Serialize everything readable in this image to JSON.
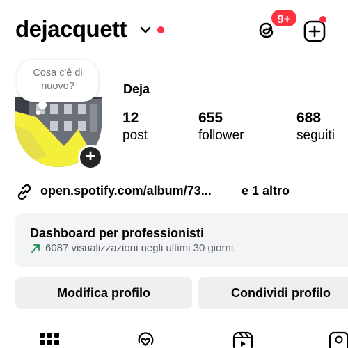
{
  "header": {
    "username": "dejacquett",
    "notification_badge": "9+",
    "chevron_icon": "chevron-down-icon",
    "threads_icon": "threads-icon",
    "new_post_icon": "plus-square-icon",
    "accent": "#ff3040"
  },
  "profile": {
    "note_placeholder": "Cosa c'è di nuovo?",
    "display_name": "Deja",
    "stats": [
      {
        "value": "12",
        "label": "post"
      },
      {
        "value": "655",
        "label": "follower"
      },
      {
        "value": "688",
        "label": "seguiti"
      }
    ],
    "link_text": "open.spotify.com/album/73...",
    "link_more": "e 1 altro",
    "link_icon": "link-icon"
  },
  "dashboard": {
    "title": "Dashboard per professionisti",
    "subtitle": "6087 visualizzazioni negli ultimi 30 giorni.",
    "trend_icon": "trend-up-arrow-icon",
    "trend_color": "#1f8a4c"
  },
  "buttons": {
    "edit": "Modifica profilo",
    "share": "Condividi profilo"
  },
  "tabs": [
    {
      "icon": "grid-icon"
    },
    {
      "icon": "collabs-icon"
    },
    {
      "icon": "reels-icon"
    },
    {
      "icon": "tagged-icon"
    }
  ]
}
